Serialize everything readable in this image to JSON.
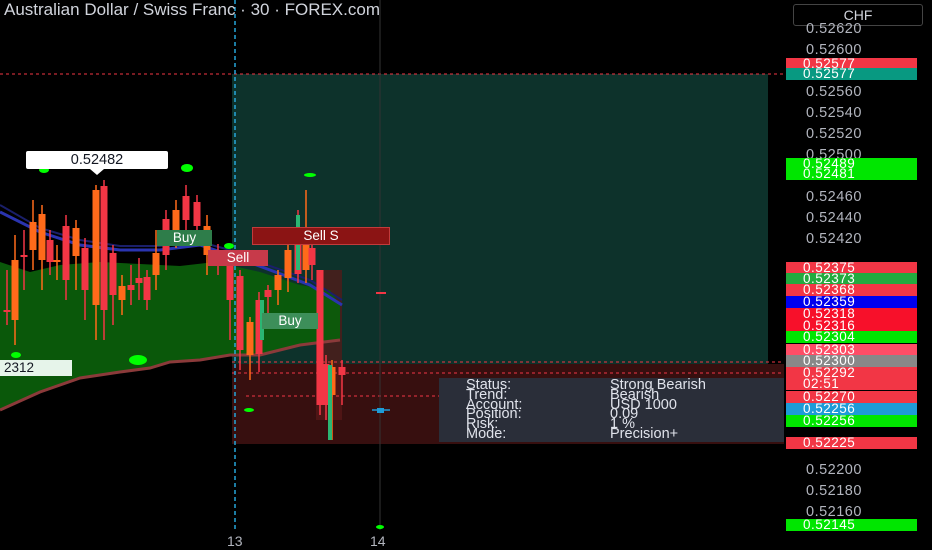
{
  "header": {
    "title": "Australian Dollar / Swiss Franc · 30 · FOREX.com"
  },
  "axis": {
    "currency": "CHF",
    "ticks": [
      "0.52620",
      "0.52600",
      "0.52560",
      "0.52540",
      "0.52520",
      "0.52500",
      "0.52460",
      "0.52440",
      "0.52420",
      "0.52200",
      "0.52180",
      "0.52160"
    ],
    "badges": [
      {
        "text": "0.52577",
        "color": "#f23645"
      },
      {
        "text": "0.52577",
        "color": "#089981"
      },
      {
        "text": "0.52489",
        "color": "#00e600"
      },
      {
        "text": "0.52481",
        "color": "#00e600"
      },
      {
        "text": "0.52375",
        "color": "#f23645"
      },
      {
        "text": "0.52373",
        "color": "#22ab3f"
      },
      {
        "text": "0.52368",
        "color": "#f23645"
      },
      {
        "text": "0.52359",
        "color": "#0000ee"
      },
      {
        "text": "0.52318",
        "color": "#f7102a"
      },
      {
        "text": "0.52316",
        "color": "#f7102a"
      },
      {
        "text": "0.52304",
        "color": "#00e600"
      },
      {
        "text": "0.52303",
        "color": "#ff4d66"
      },
      {
        "text": "0.52300",
        "color": "#888888"
      },
      {
        "text": "0.52292",
        "color": "#f23645"
      },
      {
        "text": "02:51",
        "color": "#f23645"
      },
      {
        "text": "0.52270",
        "color": "#f23645"
      },
      {
        "text": "0.52256",
        "color": "#1e9bd7"
      },
      {
        "text": "0.52256",
        "color": "#00e600"
      },
      {
        "text": "0.52225",
        "color": "#f23645"
      },
      {
        "text": "0.52145",
        "color": "#00e600"
      }
    ]
  },
  "xaxis": {
    "labels": [
      "13",
      "14"
    ]
  },
  "chart": {
    "callout_price": "0.52482",
    "left_tag": "2312",
    "signal_labels": {
      "sell_s": "Sell S",
      "buy1": "Buy",
      "sell1": "Sell",
      "buy2": "Buy"
    }
  },
  "panel": {
    "rows": [
      {
        "key": "Status:",
        "value": "Strong Bearish"
      },
      {
        "key": "Trend:",
        "value": "Bearish"
      },
      {
        "key": "Account:",
        "value": "USD 1000"
      },
      {
        "key": "Position:",
        "value": "0.09"
      },
      {
        "key": "Risk:",
        "value": "1 %"
      },
      {
        "key": "Mode:",
        "value": "Precision+"
      }
    ]
  },
  "colors": {
    "bull": "#ff6a1a",
    "bear": "#f23645",
    "cloud": "#0b5d0b",
    "target_zone": "#0f3b33",
    "stop_zone": "#3d1111"
  }
}
